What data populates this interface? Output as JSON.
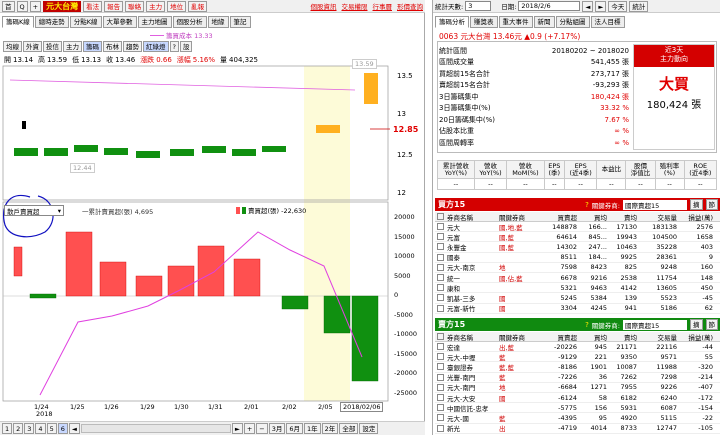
{
  "left": {
    "top_icons": [
      "首",
      "Q",
      "+"
    ],
    "stock_name": "元大台灣",
    "menu": [
      "看法",
      "報告",
      "聯絡",
      "主力",
      "地位",
      "亂報"
    ],
    "top_links": [
      "個股資訊",
      "交易權限",
      "行事曆",
      "形價查詢"
    ],
    "tabs": [
      "籌碼K線",
      "總時走勢",
      "分點K線",
      "大單參數",
      "主力地圖",
      "個股分析",
      "地緣",
      "筆記"
    ],
    "legend_cost": "籌買成本 13.33",
    "indicator_buttons": [
      "均線",
      "外資",
      "投信",
      "主力",
      "籌碼",
      "布林",
      "趨勢",
      "紅綠燈",
      "?",
      "設"
    ],
    "ohlc": {
      "open_label": "開",
      "open": "13.14",
      "high_label": "高",
      "high": "13.59",
      "low_label": "低",
      "low": "13.13",
      "close_label": "收",
      "close": "13.46",
      "chg_label": "漲跌",
      "chg": "0.66",
      "pct_label": "漲幅",
      "pct": "5.16%",
      "vol_label": "量",
      "vol": "404,325"
    },
    "last_price_box": "13.59",
    "low_label_box": "12.44",
    "y_axis_price": [
      "13.5",
      "13",
      "12.85",
      "12.5",
      "12"
    ],
    "chip_select": "散戶賣買超",
    "legend_cum": "一累計賣買超(張) 4,695",
    "legend_daily": "賣買超(張) -22,630",
    "y_axis_vol": [
      "20000",
      "15000",
      "10000",
      "5000",
      "0",
      "-5000",
      "-10000",
      "-15000",
      "-20000",
      "-25000"
    ],
    "x_labels": [
      "1/24",
      "1/25",
      "1/26",
      "1/29",
      "1/30",
      "1/31",
      "2/01",
      "2/02",
      "2/05"
    ],
    "year": "2018",
    "date_box": "2018/02/06",
    "pages": [
      "1",
      "2",
      "3",
      "4",
      "5",
      "6"
    ],
    "bottom_buttons": [
      "3月",
      "6月",
      "1年",
      "2年",
      "全部",
      "設定"
    ],
    "arrow_left": "◄",
    "arrow_right": "►",
    "colors": {
      "up": "#ff5050",
      "down": "#109010",
      "last": "#ffb020",
      "pink": "#e060e0"
    }
  },
  "right": {
    "stat_label": "統計天數:",
    "stat_days": "3",
    "date_label": "日期:",
    "date": "2018/2/6",
    "today_btn": "今天",
    "calc_btn": "統計",
    "tabs": [
      "籌碼分析",
      "賺獎表",
      "重大事件",
      "新聞",
      "分點組圖",
      "法人目標"
    ],
    "stock": "0063 元大台灣 13.46元 ▲0.9 (+7.17%)",
    "stats": [
      {
        "label": "統計區間",
        "value": "20180202 ~ 2018020"
      },
      {
        "label": "區間成交量",
        "value": "541,455 張"
      },
      {
        "label": "買超前15名合計",
        "value": "273,717 張"
      },
      {
        "label": "賣超前15名合計",
        "value": "-93,293 張"
      },
      {
        "label": "3日籌碼集中",
        "value": "180,424 張"
      },
      {
        "label": "3日籌碼集中(%)",
        "value": "33.32 %"
      },
      {
        "label": "20日籌碼集中(%)",
        "value": "7.67 %"
      },
      {
        "label": "佔股本比重",
        "value": "∞ %"
      },
      {
        "label": "區間周轉率",
        "value": "∞ %"
      }
    ],
    "trend_title": "近3天\n主力動向",
    "trend_big": "大買",
    "trend_amount": "180,424 張",
    "fund_headers": [
      "累計營收\nYoY(%)",
      "營收\nYoY(%)",
      "營收\nMoM(%)",
      "EPS\n(季)",
      "EPS\n(近4季)",
      "本益比",
      "股價\n淨值比",
      "殖利率\n(%)",
      "ROE\n(近4季)"
    ],
    "fund_values": [
      "--",
      "--",
      "--",
      "--",
      "--",
      "--",
      "--",
      "--",
      "--"
    ],
    "buy_title": "買方15",
    "sell_title": "賣方15",
    "rel_label": "關鍵券商:",
    "rel_select": "國際賣超15",
    "edit_btn": "摘",
    "filter_btn": "節",
    "cols": [
      "券商名稱",
      "關鍵券商",
      "買賣超",
      "買均",
      "賣均",
      "交易量",
      "損益(萬)"
    ],
    "buy_rows": [
      [
        "元大",
        "國,地,藍",
        "148878",
        "166...",
        "17130",
        "183138",
        "2576"
      ],
      [
        "元富",
        "國,藍",
        "64614",
        "845...",
        "19943",
        "104500",
        "1658"
      ],
      [
        "永豐金",
        "國,藍",
        "14302",
        "247...",
        "10463",
        "35228",
        "403"
      ],
      [
        "國泰",
        "",
        "8511",
        "184...",
        "9925",
        "28361",
        "9"
      ],
      [
        "元大-南京",
        "地",
        "7598",
        "8423",
        "825",
        "9248",
        "160"
      ],
      [
        "統一",
        "國,佔,藍",
        "6678",
        "9216",
        "2538",
        "11754",
        "148"
      ],
      [
        "康和",
        "",
        "5321",
        "9463",
        "4142",
        "13605",
        "450"
      ],
      [
        "凱基-三多",
        "國",
        "5245",
        "5384",
        "139",
        "5523",
        "-45"
      ],
      [
        "元富-新竹",
        "國",
        "3304",
        "4245",
        "941",
        "5186",
        "62"
      ]
    ],
    "sell_rows": [
      [
        "宏達",
        "出,藍",
        "-20226",
        "945",
        "21171",
        "22116",
        "-44"
      ],
      [
        "元大-中壢",
        "藍",
        "-9129",
        "221",
        "9350",
        "9571",
        "55"
      ],
      [
        "臺銀證券",
        "藍,藍",
        "-8186",
        "1901",
        "10087",
        "11988",
        "-320"
      ],
      [
        "光豐-南門",
        "藍",
        "-7226",
        "36",
        "7262",
        "7298",
        "-214"
      ],
      [
        "元大-南門",
        "地",
        "-6684",
        "1271",
        "7955",
        "9226",
        "-407"
      ],
      [
        "元大-大安",
        "國",
        "-6124",
        "58",
        "6182",
        "6240",
        "-172"
      ],
      [
        "中國信託-忠孝",
        "",
        "-5775",
        "156",
        "5931",
        "6087",
        "-154"
      ],
      [
        "元大-國",
        "藍",
        "-4395",
        "95",
        "4920",
        "5115",
        "-22"
      ],
      [
        "新光",
        "出",
        "-4719",
        "4014",
        "8733",
        "12747",
        "-105"
      ]
    ]
  }
}
